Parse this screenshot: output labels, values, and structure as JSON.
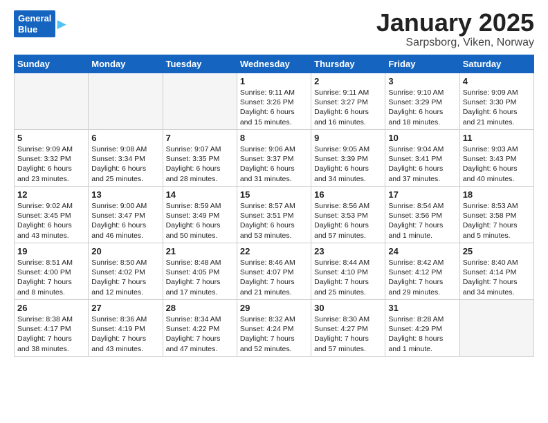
{
  "header": {
    "logo_line1": "General",
    "logo_line2": "Blue",
    "title": "January 2025",
    "subtitle": "Sarpsborg, Viken, Norway"
  },
  "days_of_week": [
    "Sunday",
    "Monday",
    "Tuesday",
    "Wednesday",
    "Thursday",
    "Friday",
    "Saturday"
  ],
  "weeks": [
    [
      {
        "day": "",
        "info": ""
      },
      {
        "day": "",
        "info": ""
      },
      {
        "day": "",
        "info": ""
      },
      {
        "day": "1",
        "info": "Sunrise: 9:11 AM\nSunset: 3:26 PM\nDaylight: 6 hours\nand 15 minutes."
      },
      {
        "day": "2",
        "info": "Sunrise: 9:11 AM\nSunset: 3:27 PM\nDaylight: 6 hours\nand 16 minutes."
      },
      {
        "day": "3",
        "info": "Sunrise: 9:10 AM\nSunset: 3:29 PM\nDaylight: 6 hours\nand 18 minutes."
      },
      {
        "day": "4",
        "info": "Sunrise: 9:09 AM\nSunset: 3:30 PM\nDaylight: 6 hours\nand 21 minutes."
      }
    ],
    [
      {
        "day": "5",
        "info": "Sunrise: 9:09 AM\nSunset: 3:32 PM\nDaylight: 6 hours\nand 23 minutes."
      },
      {
        "day": "6",
        "info": "Sunrise: 9:08 AM\nSunset: 3:34 PM\nDaylight: 6 hours\nand 25 minutes."
      },
      {
        "day": "7",
        "info": "Sunrise: 9:07 AM\nSunset: 3:35 PM\nDaylight: 6 hours\nand 28 minutes."
      },
      {
        "day": "8",
        "info": "Sunrise: 9:06 AM\nSunset: 3:37 PM\nDaylight: 6 hours\nand 31 minutes."
      },
      {
        "day": "9",
        "info": "Sunrise: 9:05 AM\nSunset: 3:39 PM\nDaylight: 6 hours\nand 34 minutes."
      },
      {
        "day": "10",
        "info": "Sunrise: 9:04 AM\nSunset: 3:41 PM\nDaylight: 6 hours\nand 37 minutes."
      },
      {
        "day": "11",
        "info": "Sunrise: 9:03 AM\nSunset: 3:43 PM\nDaylight: 6 hours\nand 40 minutes."
      }
    ],
    [
      {
        "day": "12",
        "info": "Sunrise: 9:02 AM\nSunset: 3:45 PM\nDaylight: 6 hours\nand 43 minutes."
      },
      {
        "day": "13",
        "info": "Sunrise: 9:00 AM\nSunset: 3:47 PM\nDaylight: 6 hours\nand 46 minutes."
      },
      {
        "day": "14",
        "info": "Sunrise: 8:59 AM\nSunset: 3:49 PM\nDaylight: 6 hours\nand 50 minutes."
      },
      {
        "day": "15",
        "info": "Sunrise: 8:57 AM\nSunset: 3:51 PM\nDaylight: 6 hours\nand 53 minutes."
      },
      {
        "day": "16",
        "info": "Sunrise: 8:56 AM\nSunset: 3:53 PM\nDaylight: 6 hours\nand 57 minutes."
      },
      {
        "day": "17",
        "info": "Sunrise: 8:54 AM\nSunset: 3:56 PM\nDaylight: 7 hours\nand 1 minute."
      },
      {
        "day": "18",
        "info": "Sunrise: 8:53 AM\nSunset: 3:58 PM\nDaylight: 7 hours\nand 5 minutes."
      }
    ],
    [
      {
        "day": "19",
        "info": "Sunrise: 8:51 AM\nSunset: 4:00 PM\nDaylight: 7 hours\nand 8 minutes."
      },
      {
        "day": "20",
        "info": "Sunrise: 8:50 AM\nSunset: 4:02 PM\nDaylight: 7 hours\nand 12 minutes."
      },
      {
        "day": "21",
        "info": "Sunrise: 8:48 AM\nSunset: 4:05 PM\nDaylight: 7 hours\nand 17 minutes."
      },
      {
        "day": "22",
        "info": "Sunrise: 8:46 AM\nSunset: 4:07 PM\nDaylight: 7 hours\nand 21 minutes."
      },
      {
        "day": "23",
        "info": "Sunrise: 8:44 AM\nSunset: 4:10 PM\nDaylight: 7 hours\nand 25 minutes."
      },
      {
        "day": "24",
        "info": "Sunrise: 8:42 AM\nSunset: 4:12 PM\nDaylight: 7 hours\nand 29 minutes."
      },
      {
        "day": "25",
        "info": "Sunrise: 8:40 AM\nSunset: 4:14 PM\nDaylight: 7 hours\nand 34 minutes."
      }
    ],
    [
      {
        "day": "26",
        "info": "Sunrise: 8:38 AM\nSunset: 4:17 PM\nDaylight: 7 hours\nand 38 minutes."
      },
      {
        "day": "27",
        "info": "Sunrise: 8:36 AM\nSunset: 4:19 PM\nDaylight: 7 hours\nand 43 minutes."
      },
      {
        "day": "28",
        "info": "Sunrise: 8:34 AM\nSunset: 4:22 PM\nDaylight: 7 hours\nand 47 minutes."
      },
      {
        "day": "29",
        "info": "Sunrise: 8:32 AM\nSunset: 4:24 PM\nDaylight: 7 hours\nand 52 minutes."
      },
      {
        "day": "30",
        "info": "Sunrise: 8:30 AM\nSunset: 4:27 PM\nDaylight: 7 hours\nand 57 minutes."
      },
      {
        "day": "31",
        "info": "Sunrise: 8:28 AM\nSunset: 4:29 PM\nDaylight: 8 hours\nand 1 minute."
      },
      {
        "day": "",
        "info": ""
      }
    ]
  ]
}
